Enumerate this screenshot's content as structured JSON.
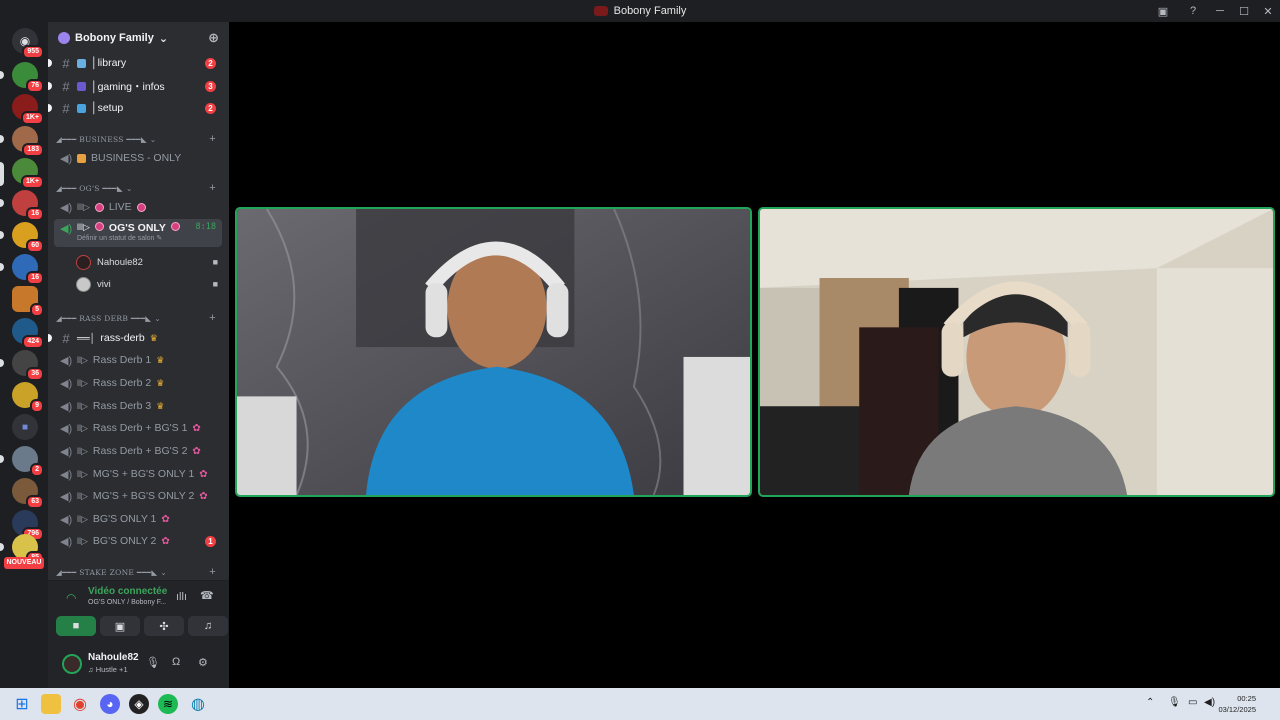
{
  "window": {
    "title": "Bobony Family"
  },
  "rail": {
    "badges": [
      "955",
      "76",
      "1K+",
      "183",
      "1K+",
      "16",
      "60",
      "16",
      "5",
      "424",
      "36",
      "9",
      "2",
      "63",
      "796",
      "85"
    ],
    "new_label": "NOUVEAU"
  },
  "guild": {
    "name": "Bobony Family"
  },
  "channels": {
    "library": {
      "name": "│library",
      "count": "2"
    },
    "gaming": {
      "name": "│gaming・infos",
      "count": "3"
    },
    "setup": {
      "name": "│setup",
      "count": "2"
    },
    "cat_business": "◢━━━ BUSINESS ━━━◣",
    "business_only": "BUSINESS - ONLY",
    "cat_ogs": "◢━━━ OG'S ━━━◣",
    "live": "LIVE",
    "ogs_only": "OG'S ONLY",
    "ogs_timer": "8:18",
    "ogs_status": "Définir un statut de salon",
    "users": [
      "Nahoule82",
      "vivi"
    ],
    "cat_rass": "◢━━━ RASS DERB ━━━◣",
    "rass_derb": "rass-derb",
    "voice": [
      "Rass Derb 1",
      "Rass Derb 2",
      "Rass Derb 3",
      "Rass Derb + BG'S 1",
      "Rass Derb + BG'S 2",
      "MG'S + BG'S ONLY 1",
      "MG'S + BG'S ONLY 2",
      "BG'S ONLY 1",
      "BG'S ONLY 2"
    ],
    "bgs2_count": "1",
    "cat_stake": "◢━━━ STAKE ZONE ━━━◣"
  },
  "voice_panel": {
    "title": "Vidéo connectée",
    "sub": "OG'S ONLY / Bobony F..."
  },
  "user_panel": {
    "name": "Nahoule82",
    "status": "Hustle +1"
  },
  "taskbar": {
    "time": "00:25",
    "date": "03/12/2025"
  },
  "colors": {
    "accent_green": "#23a559",
    "badge_red": "#f23f43"
  }
}
